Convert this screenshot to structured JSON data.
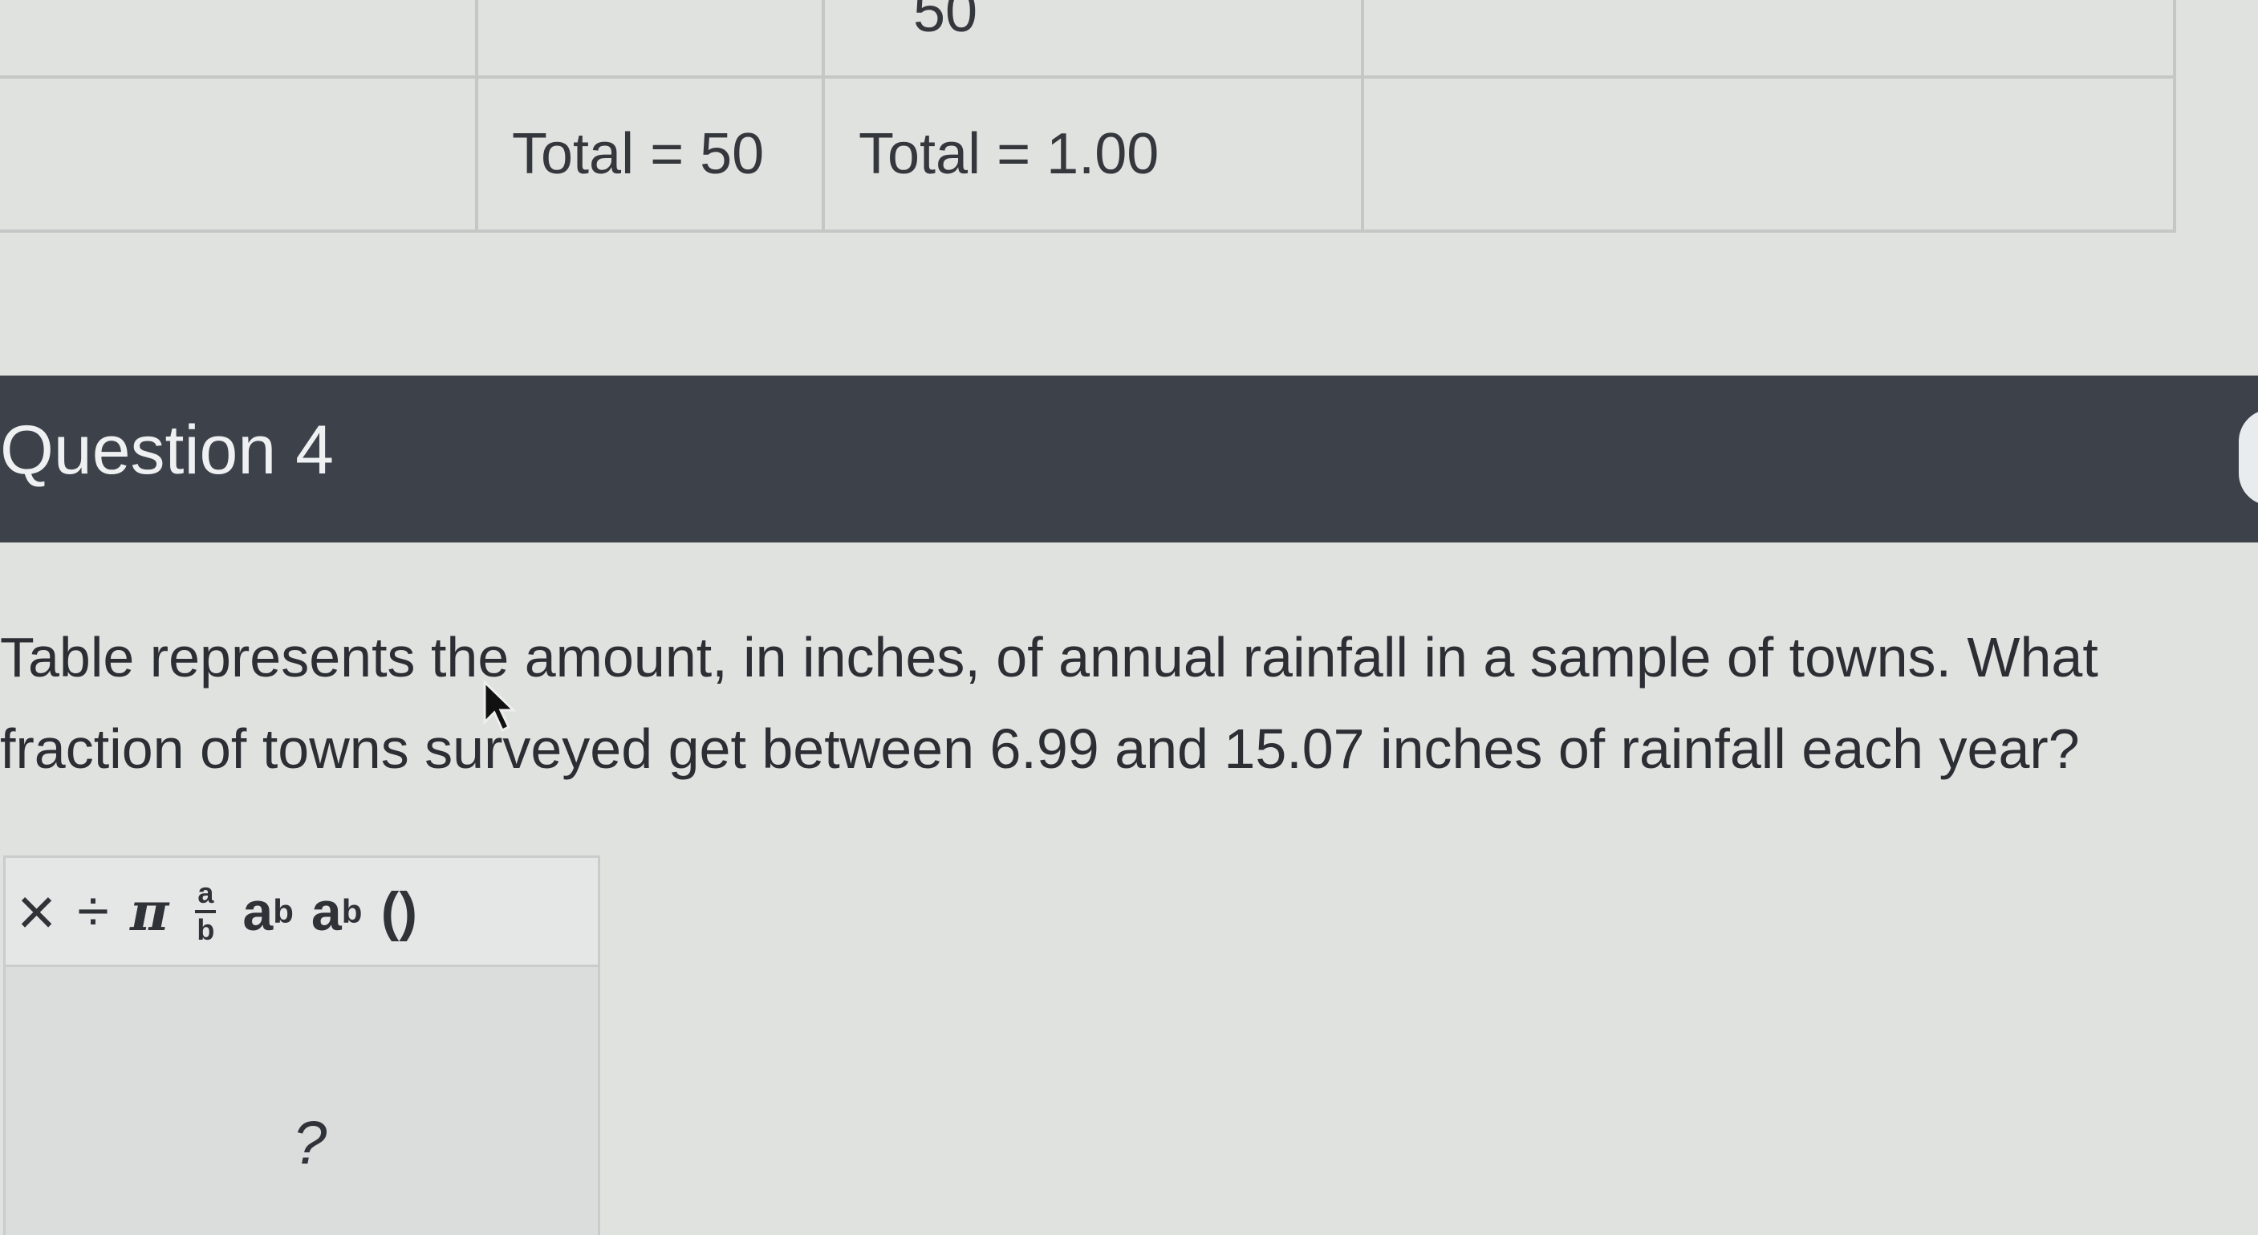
{
  "table": {
    "top_row": {
      "col_b_partial_value": "50"
    },
    "total_row": {
      "frequency_total": "Total = 50",
      "relative_frequency_total": "Total = 1.00"
    }
  },
  "question": {
    "title": "Question 4",
    "prompt_line_1": "Table represents the amount, in inches, of annual rainfall in a sample of towns. What",
    "prompt_line_2": "fraction of towns surveyed get between 6.99 and 15.07 inches of rainfall each year?"
  },
  "math_editor": {
    "toolbar": {
      "times_label": "×",
      "divide_label": "÷",
      "pi_label": "π",
      "fraction_numerator": "a",
      "fraction_denominator": "b",
      "power_base": "a",
      "power_exponent": "b",
      "subscript_base": "a",
      "subscript_index": "b",
      "parens_label": "()"
    },
    "help_label": "?"
  }
}
